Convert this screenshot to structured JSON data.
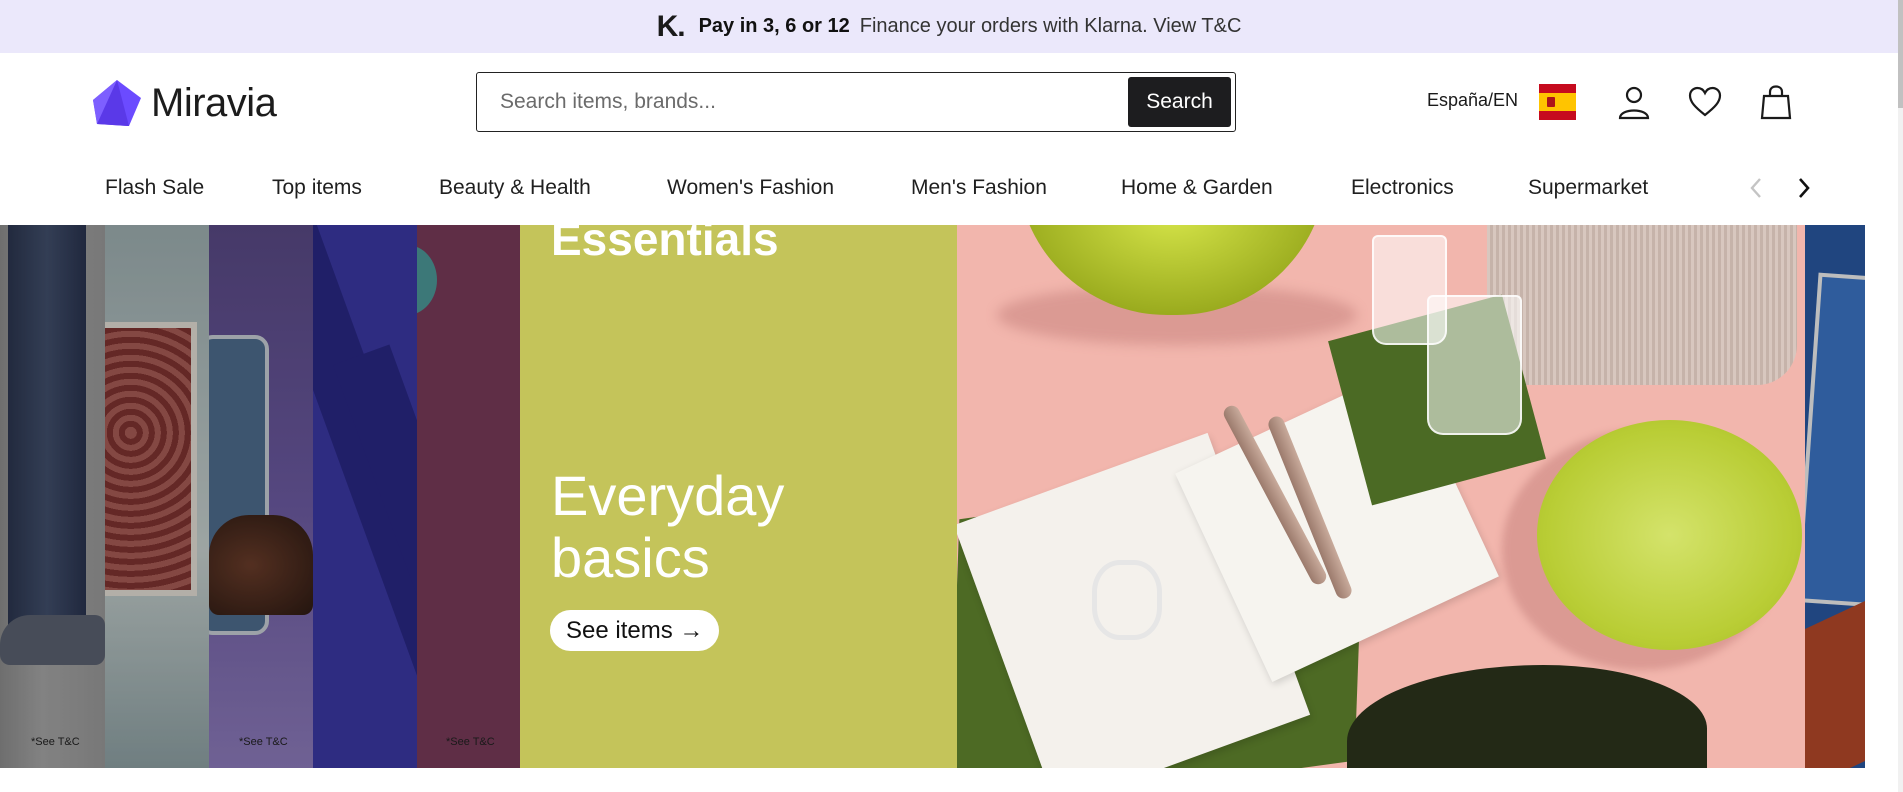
{
  "promo": {
    "logo": "K.",
    "bold_text": "Pay in 3, 6 or 12",
    "text": "Finance your orders with Klarna. View T&C"
  },
  "header": {
    "brand": "Miravia",
    "search_placeholder": "Search items, brands...",
    "search_button": "Search",
    "locale": "España/EN",
    "icons": [
      "spain-flag-icon",
      "user-icon",
      "heart-icon",
      "shopping-bag-icon"
    ]
  },
  "nav": {
    "categories": [
      "Flash Sale",
      "Top items",
      "Beauty & Health",
      "Women's Fashion",
      "Men's Fashion",
      "Home & Garden",
      "Electronics",
      "Supermarket"
    ],
    "prev_icon": "chevron-left-icon",
    "next_icon": "chevron-right-icon"
  },
  "banner": {
    "heading_top": "Essentials",
    "heading": "Everyday basics",
    "heading_line1": "Everyday",
    "heading_line2": "basics",
    "cta_label": "See items →",
    "tc_note": "*See T&C"
  },
  "colors": {
    "promo_bg": "#ebe8fb",
    "brand_purple": "#6b4bff",
    "banner_green": "#c4c45a",
    "banner_pink": "#f2b6ad",
    "search_button": "#1d1d1f"
  }
}
